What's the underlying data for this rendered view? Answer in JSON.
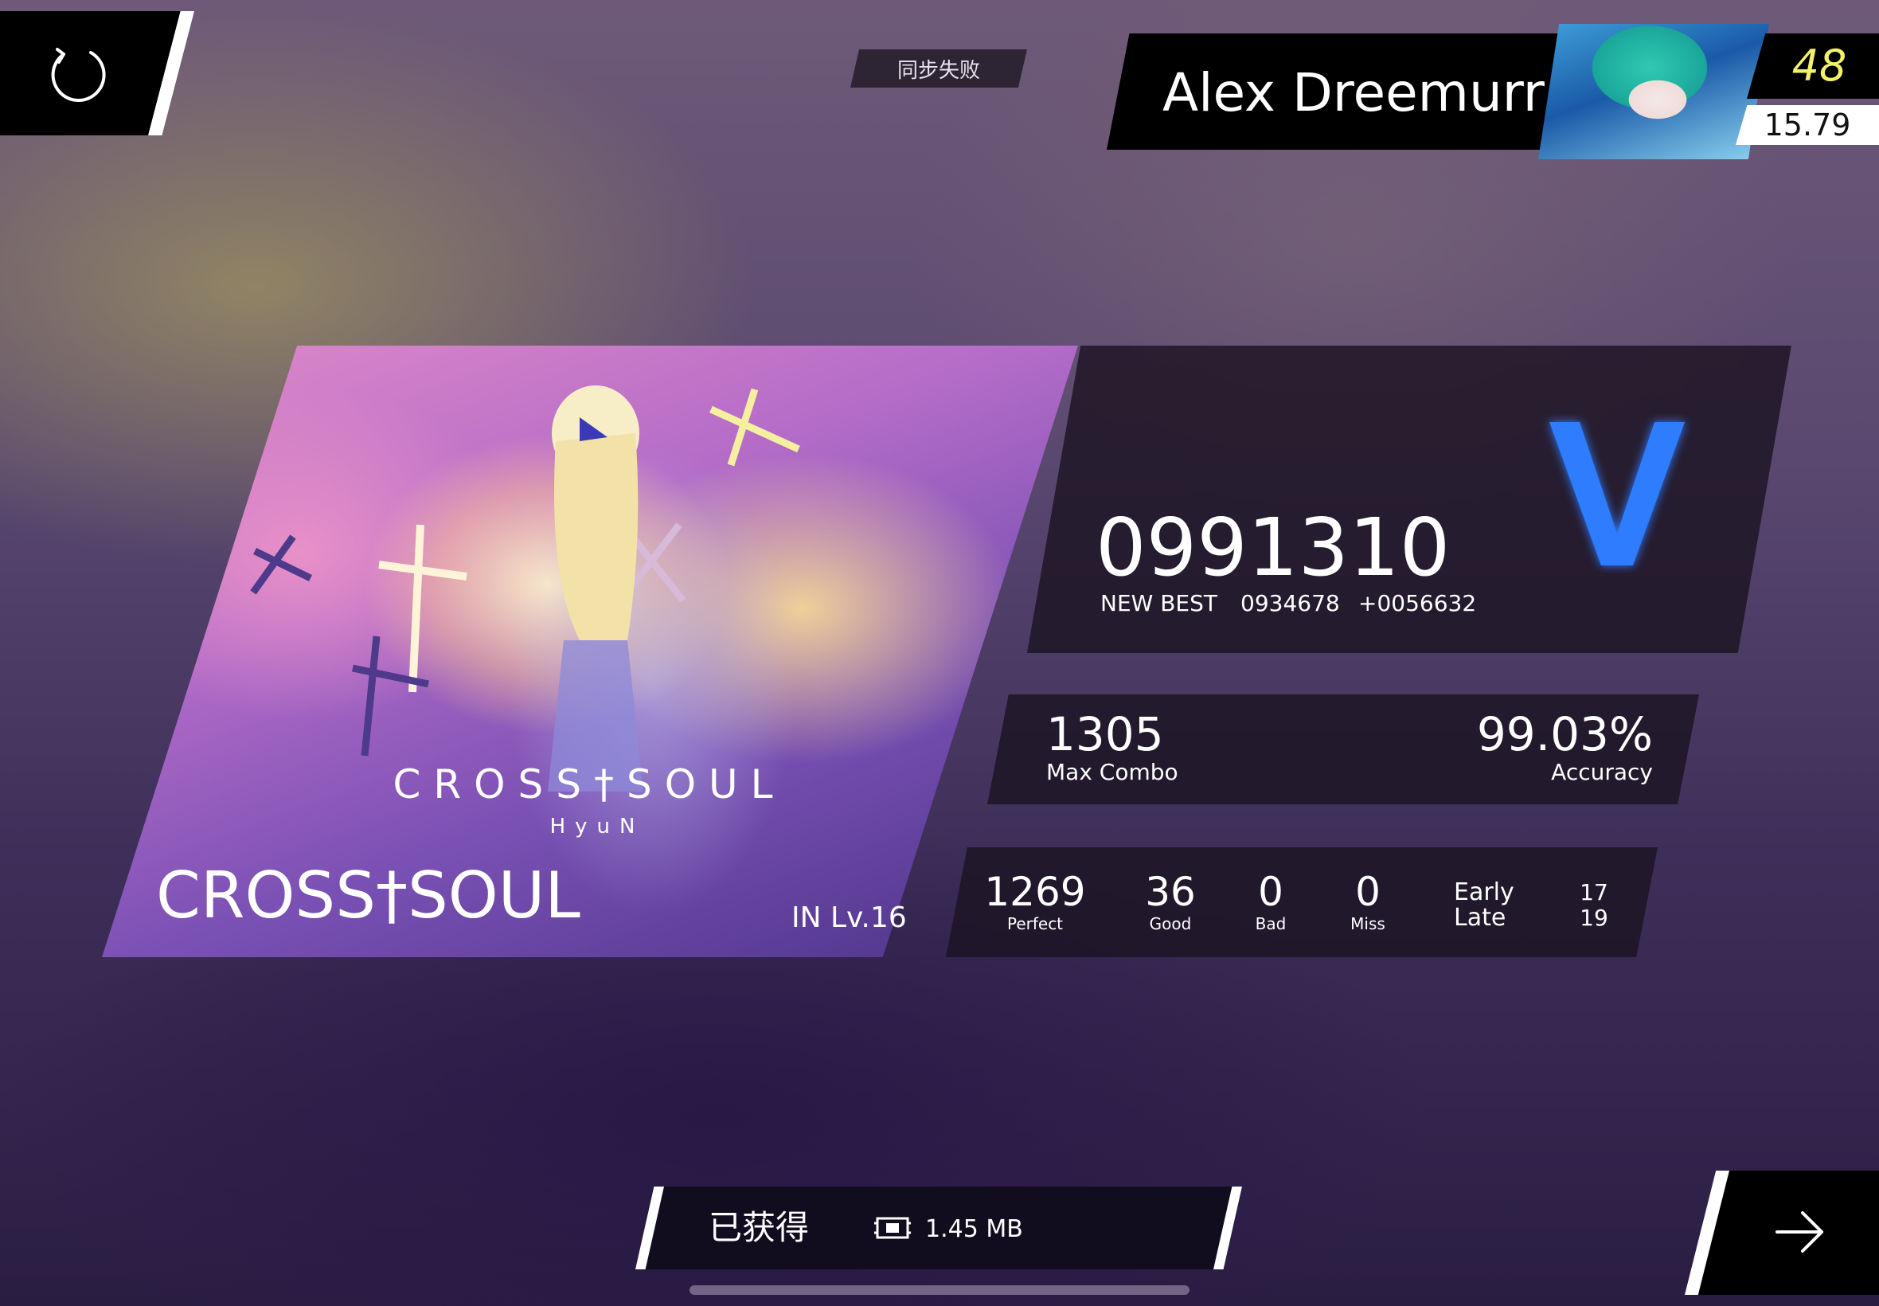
{
  "header": {
    "sync_status": "同步失败",
    "player": {
      "name": "Alex Dreemurr",
      "level": "48",
      "rks": "15.79",
      "avatar_icon": "player-avatar"
    }
  },
  "song": {
    "title": "CROSS†SOUL",
    "logo_text": "CROSS†SOUL",
    "logo_artist": "HyuN",
    "difficulty": "IN  Lv.16"
  },
  "result": {
    "score": "0991310",
    "new_best_label": "NEW BEST",
    "previous_best": "0934678",
    "score_diff": "+0056632",
    "grade": "V",
    "grade_color": "#2f7bff",
    "max_combo": "1305",
    "max_combo_label": "Max Combo",
    "accuracy": "99.03%",
    "accuracy_label": "Accuracy"
  },
  "judgements": {
    "perfect": "1269",
    "perfect_label": "Perfect",
    "good": "36",
    "good_label": "Good",
    "bad": "0",
    "bad_label": "Bad",
    "miss": "0",
    "miss_label": "Miss",
    "early_label": "Early",
    "early": "17",
    "late_label": "Late",
    "late": "19"
  },
  "bottom": {
    "obtained_label": "已获得",
    "reward_icon": "data-chip-icon",
    "file_size": "1.45 MB"
  },
  "icons": {
    "retry": "retry-icon",
    "next": "arrow-right-icon"
  }
}
